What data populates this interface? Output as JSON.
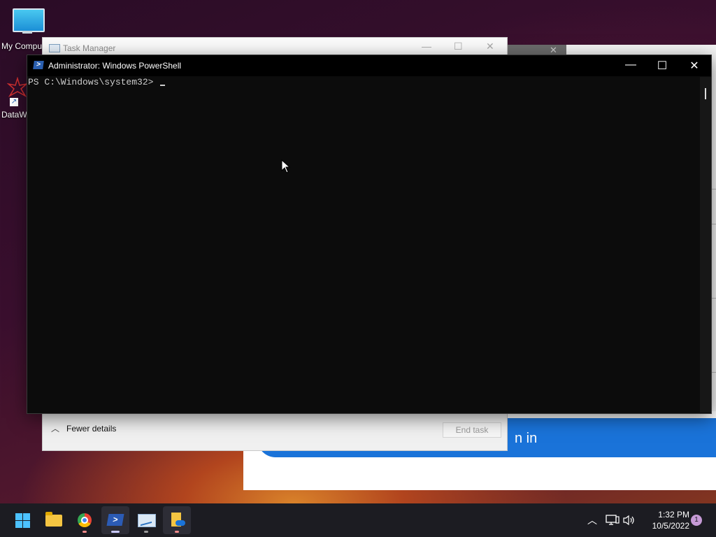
{
  "desktop": {
    "icons": [
      {
        "label": "My Compu",
        "icon": "computer-icon"
      },
      {
        "label": "DataW",
        "icon": "datawindow-icon"
      }
    ]
  },
  "task_manager": {
    "title": "Task Manager",
    "fewer_details": "Fewer details",
    "end_task": "End task"
  },
  "background": {
    "signin_partial": "n in"
  },
  "powershell": {
    "title": "Administrator: Windows PowerShell",
    "prompt": "PS C:\\Windows\\system32> "
  },
  "taskbar": {
    "apps": [
      "start-button",
      "file-explorer",
      "chrome",
      "powershell",
      "task-manager",
      "files"
    ],
    "time": "1:32 PM",
    "date": "10/5/2022",
    "notifications": "1"
  }
}
